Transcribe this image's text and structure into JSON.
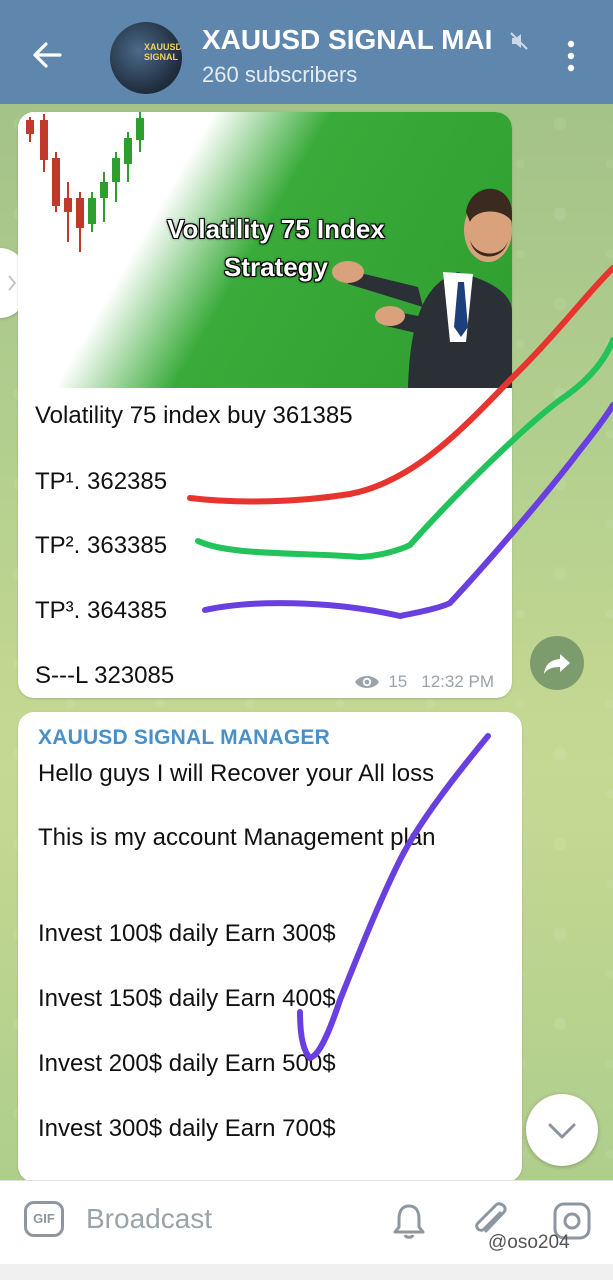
{
  "header": {
    "back_icon": "arrow-left-icon",
    "channel_name": "XAUUSD SIGNAL MAI",
    "subscribers": "260 subscribers",
    "avatar_text": "XAUUSD SIGNAL",
    "mute_icon": "muted-speaker-icon",
    "menu_icon": "kebab-menu-icon",
    "bg_color": "#5f86ad"
  },
  "post1": {
    "image_title_line1": "Volatility 75 Index",
    "image_title_line2": "Strategy",
    "lines": [
      "Volatility 75 index buy 361385",
      "TP¹. 362385",
      "TP². 363385",
      "TP³. 364385",
      "S---L 323085"
    ],
    "views": "15",
    "time": "12:32 PM"
  },
  "post2": {
    "sender": "XAUUSD SIGNAL MANAGER",
    "lines": [
      "Hello guys I will Recover your All loss",
      "This is my account Management plan",
      "Invest 100$ daily Earn 300$",
      "Invest 150$ daily Earn 400$",
      "Invest 200$ daily Earn 500$",
      "Invest 300$ daily Earn 700$"
    ]
  },
  "composer": {
    "gif_label": "GIF",
    "placeholder": "Broadcast"
  },
  "watermark": "@oso204",
  "colors": {
    "red_scribble": "#e8342e",
    "green_scribble": "#22c35a",
    "purple_scribble": "#6a3fe0",
    "sender_blue": "#4a90c8"
  }
}
